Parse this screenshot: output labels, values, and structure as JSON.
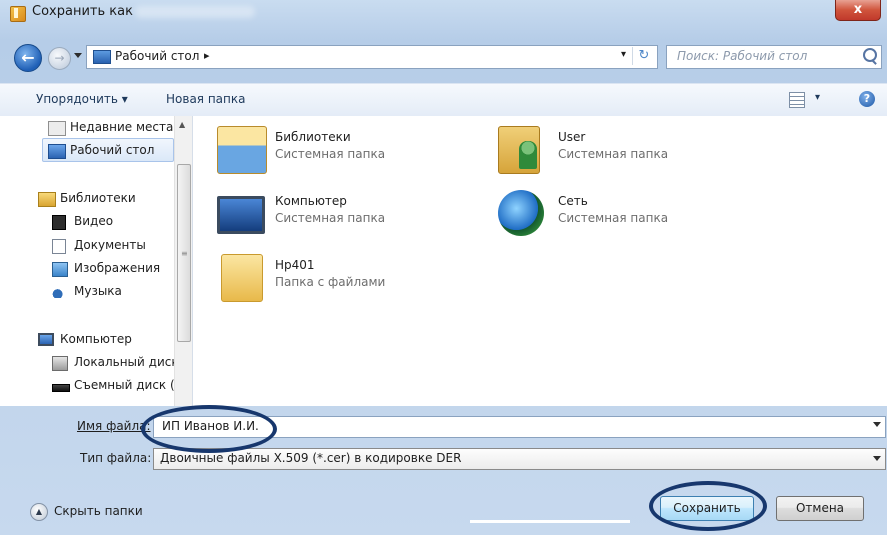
{
  "window": {
    "title": "Сохранить как",
    "close_glyph": "x"
  },
  "nav": {
    "back_glyph": "←",
    "forward_glyph": "→",
    "address": "Рабочий стол",
    "address_sep": "▸",
    "address_drop": "▾",
    "refresh_glyph": "↻",
    "search_placeholder": "Поиск: Рабочий стол"
  },
  "toolbar": {
    "organize": "Упорядочить ▾",
    "new_folder": "Новая папка",
    "views_drop": "▾",
    "help": "?"
  },
  "sidebar": {
    "scroll_up": "▲",
    "scroll_grip": "≡",
    "recent": "Недавние места",
    "desktop": "Рабочий стол",
    "libraries": "Библиотеки",
    "video": "Видео",
    "documents": "Документы",
    "images": "Изображения",
    "music": "Музыка",
    "computer": "Компьютер",
    "local_disk": "Локальный диск",
    "removable": "Съемный диск ("
  },
  "files": [
    {
      "name": "Библиотеки",
      "type": "Системная папка",
      "icon": "library-icon"
    },
    {
      "name": "User",
      "type": "Системная папка",
      "icon": "user-folder-icon"
    },
    {
      "name": "Компьютер",
      "type": "Системная папка",
      "icon": "computer-icon"
    },
    {
      "name": "Сеть",
      "type": "Системная папка",
      "icon": "network-icon"
    },
    {
      "name": "Hp401",
      "type": "Папка с файлами",
      "icon": "folder-icon"
    }
  ],
  "form": {
    "filename_label": "Имя файла:",
    "filename_value": "ИП Иванов И.И.",
    "filetype_label": "Тип файла:",
    "filetype_value": "Двоичные файлы X.509 (*.cer) в кодировке DER"
  },
  "footer": {
    "hide_folders": "Скрыть папки",
    "hide_glyph": "▲",
    "save": "Сохранить",
    "cancel": "Отмена"
  },
  "colors": {
    "annotation": "#17376d",
    "selection": "#dbe8f8",
    "frame": "#c3d7ef"
  }
}
